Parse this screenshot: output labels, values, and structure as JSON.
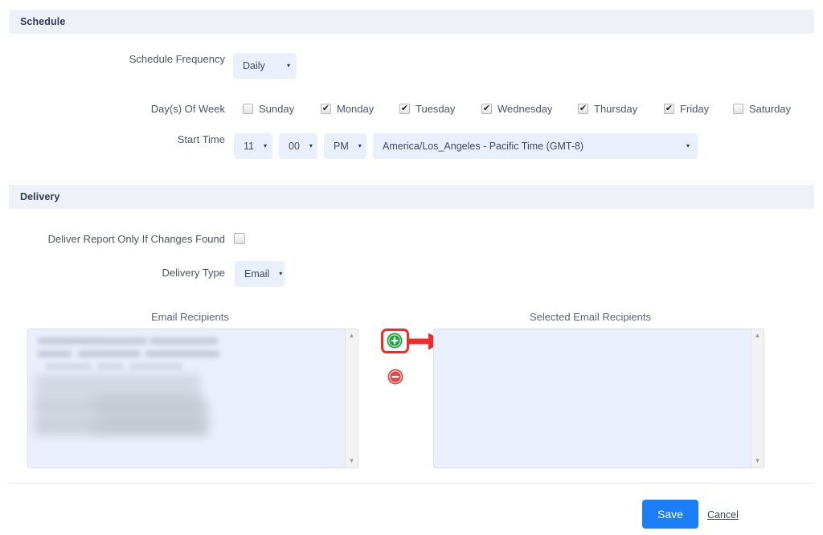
{
  "sections": {
    "schedule": {
      "title": "Schedule"
    },
    "delivery": {
      "title": "Delivery"
    }
  },
  "schedule": {
    "frequency_label": "Schedule Frequency",
    "frequency_value": "Daily",
    "days_label": "Day(s) Of Week",
    "days": [
      {
        "label": "Sunday",
        "checked": false
      },
      {
        "label": "Monday",
        "checked": true
      },
      {
        "label": "Tuesday",
        "checked": true
      },
      {
        "label": "Wednesday",
        "checked": true
      },
      {
        "label": "Thursday",
        "checked": true
      },
      {
        "label": "Friday",
        "checked": true
      },
      {
        "label": "Saturday",
        "checked": false
      }
    ],
    "start_time_label": "Start Time",
    "hour_value": "11",
    "minute_value": "00",
    "meridiem_value": "PM",
    "timezone_value": "America/Los_Angeles - Pacific Time (GMT-8)"
  },
  "delivery": {
    "changes_only_label": "Deliver Report Only If Changes Found",
    "changes_only_checked": false,
    "type_label": "Delivery Type",
    "type_value": "Email",
    "recipients_label": "Email Recipients",
    "selected_recipients_label": "Selected Email Recipients",
    "add_icon": "plus-circle-icon",
    "remove_icon": "minus-circle-icon",
    "selected_recipients_items": []
  },
  "footer": {
    "save_label": "Save",
    "cancel_label": "Cancel"
  },
  "colors": {
    "accent_blue": "#1b7ef7",
    "section_bar": "#eef1f8",
    "field_bg": "#eaf0fb",
    "add_green": "#18a33c",
    "remove_red": "#db4a44",
    "annotation_red": "#ef2b2b"
  },
  "caret_glyph": "▾"
}
